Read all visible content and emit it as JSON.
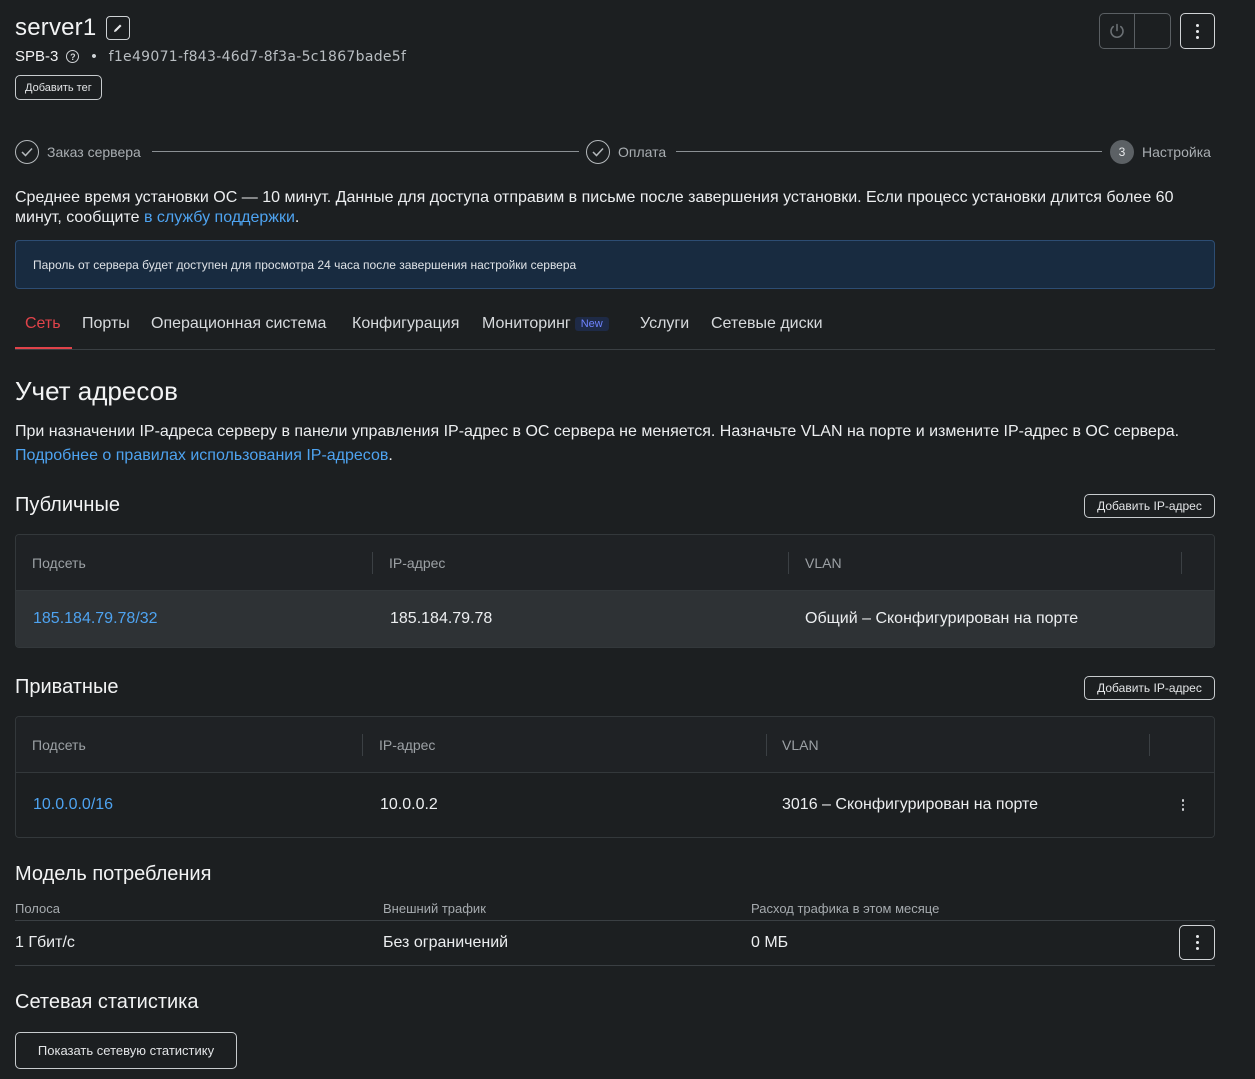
{
  "header": {
    "server_name": "server1",
    "region": "SPB-3",
    "server_uuid": "f1e49071-f843-46d7-8f3a-5c1867bade5f",
    "add_tag_label": "Добавить тег"
  },
  "stepper": {
    "steps": [
      {
        "label": "Заказ сервера",
        "state": "done"
      },
      {
        "label": "Оплата",
        "state": "done"
      },
      {
        "label": "Настройка",
        "state": "current",
        "number": "3"
      }
    ]
  },
  "install_info": {
    "text": "Среднее время установки ОС — 10 минут. Данные для доступа отправим в письме после завершения установки. Если процесс установки длится более 60 минут, сообщите ",
    "link": "в службу поддержки",
    "suffix": "."
  },
  "notice": {
    "text": "Пароль от сервера будет доступен для просмотра 24 часа после завершения настройки сервера"
  },
  "tabs": [
    {
      "label": "Сеть",
      "active": true
    },
    {
      "label": "Порты"
    },
    {
      "label": "Операционная система"
    },
    {
      "label": "Конфигурация"
    },
    {
      "label": "Мониторинг",
      "badge": "New"
    },
    {
      "label": "Услуги"
    },
    {
      "label": "Сетевые диски"
    }
  ],
  "addresses": {
    "title": "Учет адресов",
    "description": "При назначении IP-адреса серверу в панели управления IP-адрес в ОС сервера не меняется. Назначьте VLAN на порте и измените IP-адрес в ОС сервера.",
    "link": "Подробнее о правилах использования IP-адресов",
    "link_suffix": "."
  },
  "public": {
    "title": "Публичные",
    "add_label": "Добавить IP-адрес",
    "columns": [
      "Подсеть",
      "IP-адрес",
      "VLAN"
    ],
    "rows": [
      {
        "subnet": "185.184.79.78/32",
        "ip": "185.184.79.78",
        "vlan": "Общий – Сконфигурирован на порте"
      }
    ]
  },
  "private": {
    "title": "Приватные",
    "add_label": "Добавить IP-адрес",
    "columns": [
      "Подсеть",
      "IP-адрес",
      "VLAN"
    ],
    "rows": [
      {
        "subnet": "10.0.0.0/16",
        "ip": "10.0.0.2",
        "vlan": "3016 – Сконфигурирован на порте"
      }
    ]
  },
  "consumption": {
    "title": "Модель потребления",
    "labels": [
      "Полоса",
      "Внешний трафик",
      "Расход трафика в этом месяце"
    ],
    "values": [
      "1 Гбит/с",
      "Без ограничений",
      "0 МБ"
    ]
  },
  "network_stats": {
    "title": "Сетевая статистика",
    "button_label": "Показать сетевую статистику"
  },
  "icons": {
    "edit": "pencil-icon",
    "help": "question-circle-icon",
    "power": "power-icon",
    "more": "kebab-menu-icon",
    "step_done": "check-circle-icon"
  },
  "colors": {
    "background": "#1c1f21",
    "accent_red": "#e0434a",
    "link_blue": "#4ea3f0",
    "notice_bg": "#182b40",
    "badge_text": "#6f84ff"
  }
}
